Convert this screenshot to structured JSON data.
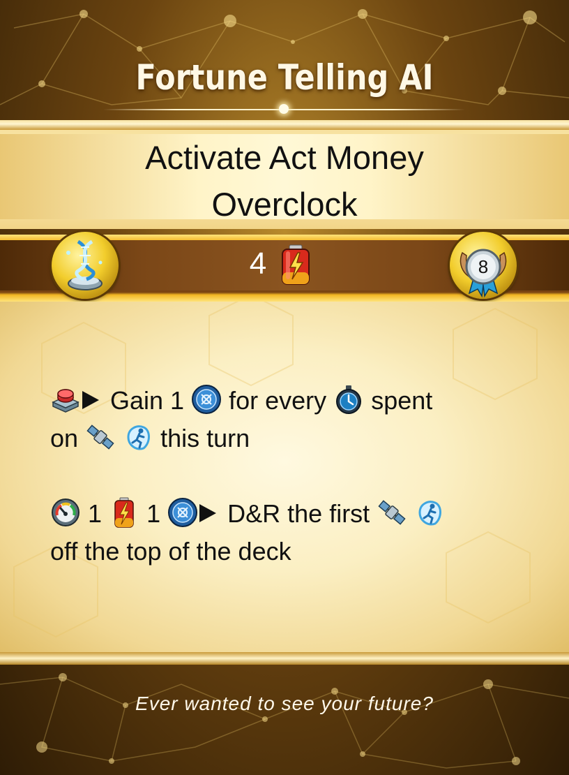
{
  "card": {
    "title": "Fortune Telling AI",
    "name_line1": "Activate Act Money",
    "name_line2": "Overclock",
    "cost": "4",
    "rank": "8",
    "flavor": "Ever wanted to see your future?"
  },
  "abilities": [
    {
      "tokens": [
        {
          "icon": "trigger-button-icon"
        },
        {
          "text": "Gain 1"
        },
        {
          "icon": "coin-icon"
        },
        {
          "text": "for every"
        },
        {
          "icon": "stopwatch-icon"
        },
        {
          "text": "spent on"
        },
        {
          "icon": "satellite-icon"
        },
        {
          "icon": "runner-icon"
        },
        {
          "text": "this turn"
        }
      ],
      "text_a": "Gain 1",
      "text_b": "for every",
      "text_c": "spent",
      "text_d": "on",
      "text_e": "this turn"
    },
    {
      "text_a": "1",
      "text_b": "1",
      "text_c": "D&R the first",
      "text_d": "off the top of the deck"
    }
  ],
  "colors": {
    "gold": "#f2cd2c",
    "dark_band": "#6a3a10",
    "battery_red": "#d92a1c"
  }
}
